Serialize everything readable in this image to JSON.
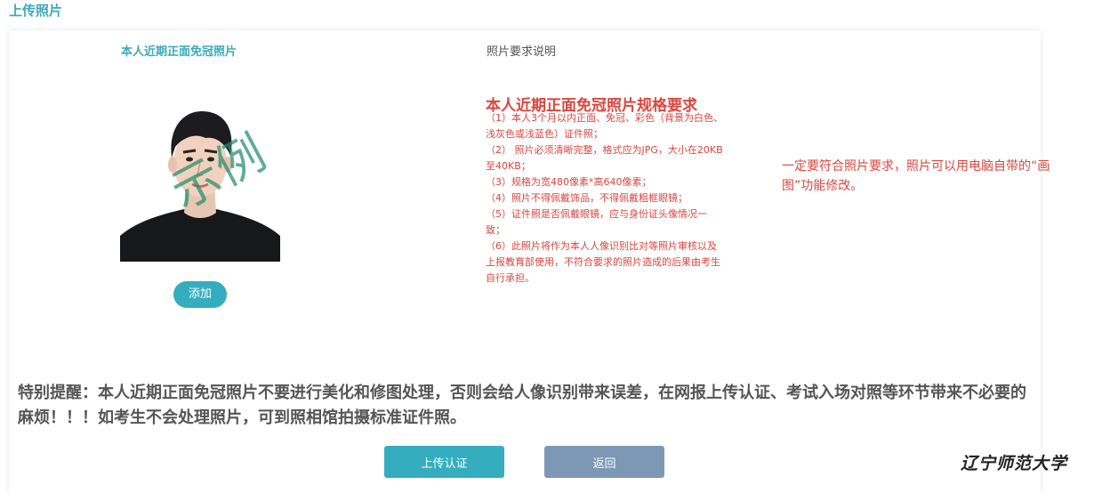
{
  "page": {
    "title": "上传照片"
  },
  "photo_section": {
    "heading": "本人近期正面免冠照片",
    "watermark": "示例",
    "add_label": "添加"
  },
  "requirements": {
    "heading": "照片要求说明",
    "spec_title": "本人近期正面免冠照片规格要求",
    "items": [
      "（1）本人3个月以内正面、免冠、彩色（背景为白色、浅灰色或浅蓝色）证件照；",
      "（2） 照片必须清晰完整，格式应为JPG，大小在20KB至40KB；",
      "（3）规格为宽480像素*高640像素；",
      "（4）照片不得佩戴饰品，不得佩戴粗框眼镜；",
      "（5）证件照是否佩戴眼镜，应与身份证头像情况一致；",
      "（6）此照片将作为本人人像识别比对等照片审核以及上报教育部使用，不符合要求的照片造成的后果由考生自行承担。"
    ],
    "side_note": "一定要符合照片要求，照片可以用电脑自带的“画图”功能修改。"
  },
  "reminder": {
    "text": "特别提醒：本人近期正面免冠照片不要进行美化和修图处理，否则会给人像识别带来误差，在网报上传认证、考试入场对照等环节带来不必要的麻烦！！！如考生不会处理照片，可到照相馆拍摄标准证件照。"
  },
  "actions": {
    "upload_label": "上传认证",
    "back_label": "返回"
  },
  "brand": {
    "logo_text": "辽宁师范大学"
  },
  "colors": {
    "accent": "#34aebf",
    "warning_red": "#d9473f",
    "back_button": "#7d98b5"
  }
}
